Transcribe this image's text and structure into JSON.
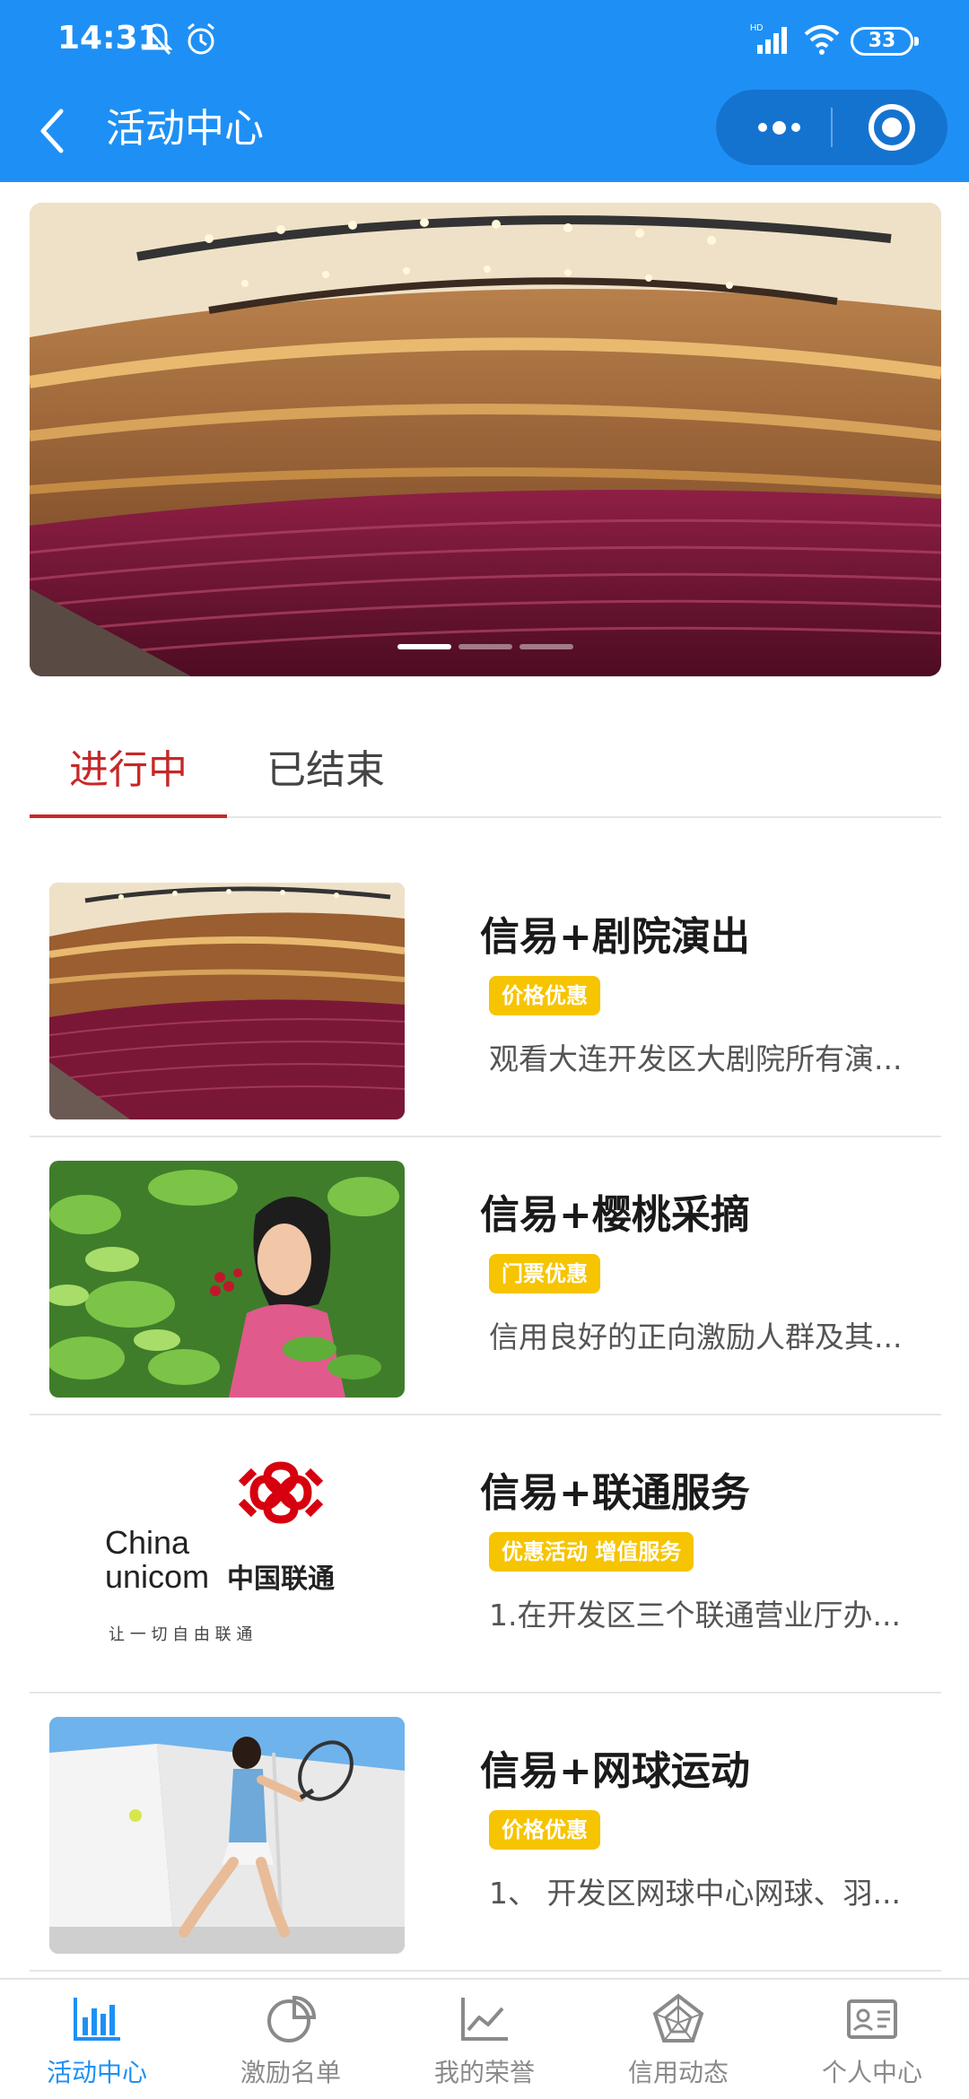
{
  "status_bar": {
    "time": "14:31",
    "battery": "33",
    "network": "HD"
  },
  "nav": {
    "title": "活动中心"
  },
  "banner": {
    "image": "theater-auditorium-photo",
    "slide_count": 3,
    "active_slide": 1
  },
  "tabs": [
    {
      "label": "进行中",
      "active": true
    },
    {
      "label": "已结束",
      "active": false
    }
  ],
  "activities": [
    {
      "title": "信易+剧院演出",
      "tag": "价格优惠",
      "desc": "观看大连开发区大剧院所有演...",
      "image": "theater-photo"
    },
    {
      "title": "信易+樱桃采摘",
      "tag": "门票优惠",
      "desc": "信用良好的正向激励人群及其...",
      "image": "cherry-picking-photo"
    },
    {
      "title": "信易+联通服务",
      "tag": "优惠活动 增值服务",
      "desc": "1.在开发区三个联通营业厅办...",
      "image": "china-unicom-logo"
    },
    {
      "title": "信易+网球运动",
      "tag": "价格优惠",
      "desc": "1、 开发区网球中心网球、羽...",
      "image": "tennis-player-photo"
    }
  ],
  "unicom_logo": {
    "en_line1": "China",
    "en_line2": "unicom",
    "cn": "中国联通",
    "slogan": "让 一 切 自 由 联 通"
  },
  "tabbar": [
    {
      "label": "活动中心",
      "icon": "bar-chart-icon",
      "active": true
    },
    {
      "label": "激励名单",
      "icon": "pie-chart-icon",
      "active": false
    },
    {
      "label": "我的荣誉",
      "icon": "line-chart-icon",
      "active": false
    },
    {
      "label": "信用动态",
      "icon": "radar-chart-icon",
      "active": false
    },
    {
      "label": "个人中心",
      "icon": "id-card-icon",
      "active": false
    }
  ],
  "colors": {
    "header": "#1e90f5",
    "accent_red": "#c62828",
    "tag_yellow": "#f6c400",
    "tabbar_active": "#1e90f5"
  }
}
